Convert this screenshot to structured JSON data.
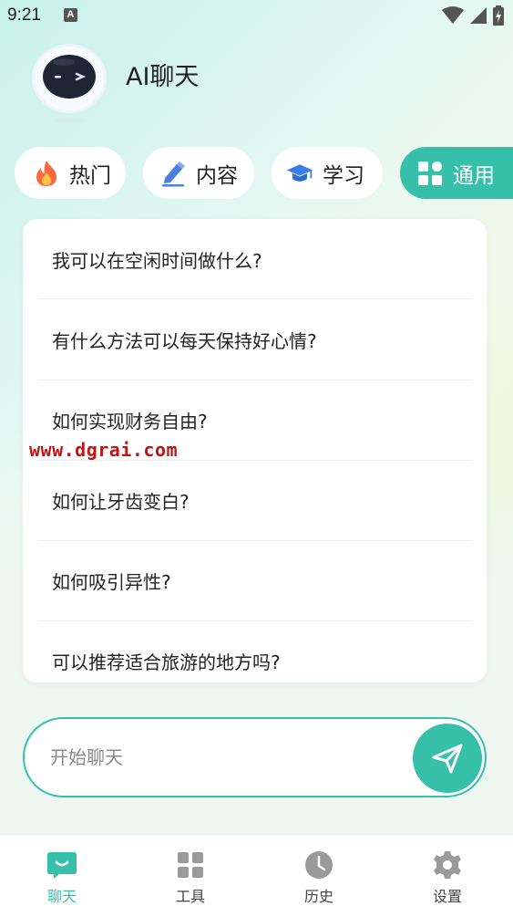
{
  "status_bar": {
    "time": "9:21",
    "notification_icon": "A"
  },
  "header": {
    "title": "AI聊天",
    "mascot_icon": "robot-mascot-icon"
  },
  "tabs": [
    {
      "label": "热门",
      "icon": "fire-icon",
      "active": false
    },
    {
      "label": "内容",
      "icon": "pen-icon",
      "active": false
    },
    {
      "label": "学习",
      "icon": "graduation-cap-icon",
      "active": false
    },
    {
      "label": "通用",
      "icon": "grid-icon",
      "active": true
    }
  ],
  "questions": [
    "我可以在空闲时间做什么?",
    "有什么方法可以每天保持好心情?",
    "如何实现财务自由?",
    "如何让牙齿变白?",
    "如何吸引异性?",
    "可以推荐适合旅游的地方吗?"
  ],
  "watermark": "www.dgrai.com",
  "chat_input": {
    "placeholder": "开始聊天",
    "value": ""
  },
  "bottom_nav": [
    {
      "label": "聊天",
      "icon": "chat-icon",
      "active": true
    },
    {
      "label": "工具",
      "icon": "grid-icon",
      "active": false
    },
    {
      "label": "历史",
      "icon": "clock-icon",
      "active": false
    },
    {
      "label": "设置",
      "icon": "gear-icon",
      "active": false
    }
  ],
  "colors": {
    "accent": "#36bfa9",
    "watermark": "#c21414"
  }
}
